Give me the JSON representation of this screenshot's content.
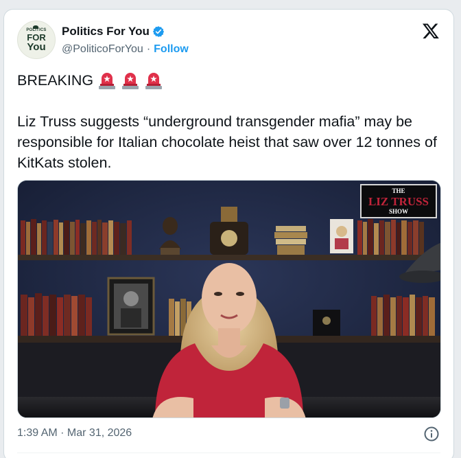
{
  "account": {
    "display_name": "Politics For You",
    "handle": "@PoliticoForYou",
    "separator": "·",
    "follow_label": "Follow",
    "avatar_text": [
      "POLITICS",
      "FOR",
      "You"
    ]
  },
  "tweet": {
    "breaking": "BREAKING",
    "body": "Liz Truss suggests “underground transgender mafia” may be responsible for Italian chocolate heist that saw over 12 tonnes of KitKats stolen.",
    "timestamp": "1:39 AM · Mar 31, 2026"
  },
  "media": {
    "show_logo": [
      "THE",
      "LIZ TRUSS",
      "SHOW"
    ]
  },
  "icons": {
    "verified": "verified-badge-icon",
    "x_logo": "x-logo-icon",
    "siren": "police-siren-emoji-icon",
    "info": "info-icon"
  },
  "colors": {
    "accent": "#1d9bf0",
    "secondary_text": "#536471",
    "dress": "#c0243a",
    "backdrop": "#1e2740"
  }
}
